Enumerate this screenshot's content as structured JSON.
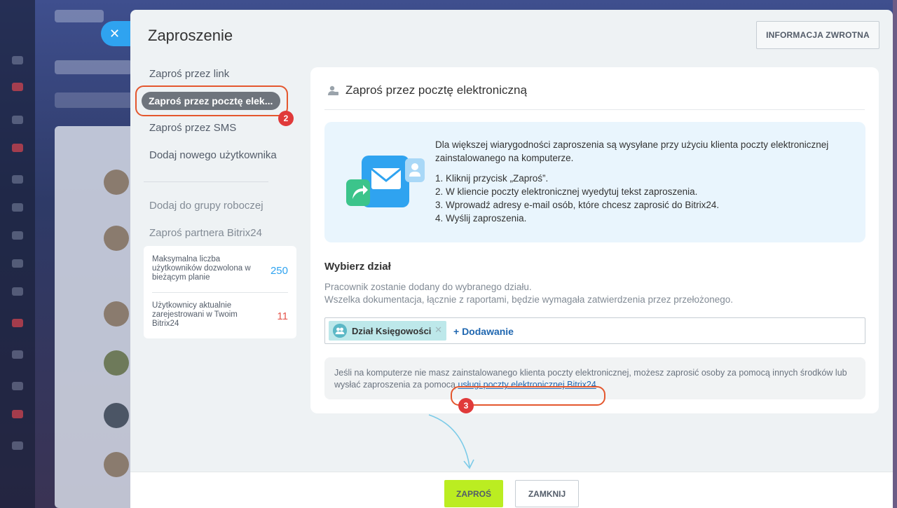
{
  "panel": {
    "title": "Zaproszenie",
    "feedback_label": "INFORMACJA ZWROTNA",
    "close_icon": "close-icon"
  },
  "menu": {
    "items": [
      {
        "label": "Zaproś przez link"
      },
      {
        "label": "Zaproś przez pocztę elek...",
        "active": true
      },
      {
        "label": "Zaproś przez SMS"
      },
      {
        "label": "Dodaj nowego użytkownika"
      },
      {
        "label": "Dodaj do grupy roboczej"
      },
      {
        "label": "Zaproś partnera Bitrix24"
      }
    ],
    "active_badge": "2"
  },
  "limits": {
    "max_label": "Maksymalna liczba użytkowników dozwolona w bieżącym planie",
    "max_value": "250",
    "max_color": "#2fa3f0",
    "current_label": "Użytkownicy aktualnie zarejestrowani w Twoim Bitrix24",
    "current_value": "11",
    "current_color": "#e5574e"
  },
  "card": {
    "title": "Zaproś przez pocztę elektroniczną",
    "icon": "user-invite-icon",
    "info_intro": "Dla większej wiarygodności zaproszenia są wysyłane przy użyciu klienta poczty elektronicznej zainstalowanego na komputerze.",
    "steps": [
      "1. Kliknij przycisk „Zaproś”.",
      "2. W kliencie poczty elektronicznej wyedytuj tekst zaproszenia.",
      "3. Wprowadź adresy e-mail osób, które chcesz zaprosić do Bitrix24.",
      "4. Wyślij zaproszenia."
    ],
    "illustration": "email-envelope-illustration"
  },
  "department": {
    "title": "Wybierz dział",
    "desc_line1": "Pracownik zostanie dodany do wybranego działu.",
    "desc_line2": "Wszelka dokumentacja, łącznie z raportami, będzie wymagała zatwierdzenia przez przełożonego.",
    "chip_label": "Dział Księgowości",
    "add_label": "+ Dodawanie"
  },
  "note": {
    "text_before": "Jeśli na komputerze nie masz zainstalowanego klienta poczty elektronicznej, możesz zaprosić osoby za pomocą innych środków lub wysłać zaproszenia za pomocą ",
    "link": "usługi poczty elektronicznej Bitrix24",
    "text_after": ".",
    "badge": "3"
  },
  "footer": {
    "invite_label": "ZAPROŚ",
    "close_label": "ZAMKNIJ"
  },
  "colors": {
    "accent_green": "#bbed21",
    "highlight_ring": "#e4572e",
    "badge_red": "#e03a3a",
    "link_blue": "#2067b0"
  }
}
